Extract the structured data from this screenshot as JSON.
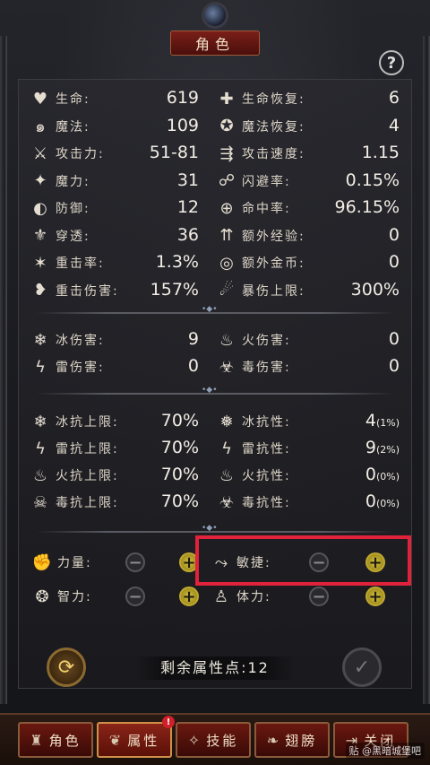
{
  "window": {
    "title": "角色"
  },
  "help": {
    "symbol": "?"
  },
  "stats_left": [
    {
      "icon": "heart-icon",
      "glyph": "♥",
      "label": "生命:",
      "value": "619"
    },
    {
      "icon": "swirl-icon",
      "glyph": "๑",
      "label": "魔法:",
      "value": "109"
    },
    {
      "icon": "sword-icon",
      "glyph": "⚔",
      "label": "攻击力:",
      "value": "51-81"
    },
    {
      "icon": "magic-icon",
      "glyph": "✦",
      "label": "魔力:",
      "value": "31"
    },
    {
      "icon": "shield-icon",
      "glyph": "◐",
      "label": "防御:",
      "value": "12"
    },
    {
      "icon": "fleur-icon",
      "glyph": "⚜",
      "label": "穿透:",
      "value": "36"
    },
    {
      "icon": "critical-icon",
      "glyph": "✶",
      "label": "重击率:",
      "value": "1.3%"
    },
    {
      "icon": "broken-heart-icon",
      "glyph": "❥",
      "label": "重击伤害:",
      "value": "157%"
    }
  ],
  "stats_right": [
    {
      "icon": "heart-plus-icon",
      "glyph": "✚",
      "label": "生命恢复:",
      "value": "6"
    },
    {
      "icon": "swirl-plus-icon",
      "glyph": "✪",
      "label": "魔法恢复:",
      "value": "4"
    },
    {
      "icon": "speed-icon",
      "glyph": "⇶",
      "label": "攻击速度:",
      "value": "1.15"
    },
    {
      "icon": "dodge-icon",
      "glyph": "☍",
      "label": "闪避率:",
      "value": "0.15%"
    },
    {
      "icon": "target-icon",
      "glyph": "⊕",
      "label": "命中率:",
      "value": "96.15%"
    },
    {
      "icon": "exp-up-icon",
      "glyph": "⇈",
      "label": "额外经验:",
      "value": "0"
    },
    {
      "icon": "coins-icon",
      "glyph": "◎",
      "label": "额外金币:",
      "value": "0"
    },
    {
      "icon": "crit-cap-icon",
      "glyph": "☄",
      "label": "暴伤上限:",
      "value": "300%"
    }
  ],
  "elem_damage": [
    {
      "icon": "ice-icon",
      "glyph": "❄",
      "label": "冰伤害:",
      "value": "9",
      "ricon": "fire-icon",
      "rglyph": "♨",
      "rlabel": "火伤害:",
      "rvalue": "0"
    },
    {
      "icon": "lightning-icon",
      "glyph": "ϟ",
      "label": "雷伤害:",
      "value": "0",
      "ricon": "poison-icon",
      "rglyph": "☣",
      "rlabel": "毒伤害:",
      "rvalue": "0"
    }
  ],
  "resists": [
    {
      "icon": "ice-cap-icon",
      "glyph": "❄",
      "label": "冰抗上限:",
      "value": "70%",
      "ricon": "ice-resist-icon",
      "rglyph": "❅",
      "rlabel": "冰抗性:",
      "rvalue": "4",
      "rpct": "(1%)"
    },
    {
      "icon": "lightning-cap-icon",
      "glyph": "ϟ",
      "label": "雷抗上限:",
      "value": "70%",
      "ricon": "lightning-resist-icon",
      "rglyph": "ϟ",
      "rlabel": "雷抗性:",
      "rvalue": "9",
      "rpct": "(2%)"
    },
    {
      "icon": "fire-cap-icon",
      "glyph": "♨",
      "label": "火抗上限:",
      "value": "70%",
      "ricon": "fire-resist-icon",
      "rglyph": "♨",
      "rlabel": "火抗性:",
      "rvalue": "0",
      "rpct": "(0%)"
    },
    {
      "icon": "poison-cap-icon",
      "glyph": "☠",
      "label": "毒抗上限:",
      "value": "70%",
      "ricon": "poison-resist-icon",
      "rglyph": "☣",
      "rlabel": "毒抗性:",
      "rvalue": "0",
      "rpct": "(0%)"
    }
  ],
  "attributes": {
    "strength": {
      "label": "力量:",
      "glyph": "✊"
    },
    "agility": {
      "label": "敏捷:",
      "glyph": "⤳"
    },
    "intellect": {
      "label": "智力:",
      "glyph": "❂"
    },
    "stamina": {
      "label": "体力:",
      "glyph": "♙"
    },
    "minus": "−",
    "plus": "+"
  },
  "remaining": {
    "text": "剩余属性点:12"
  },
  "buttons": {
    "refresh": "⟳",
    "confirm": "✓"
  },
  "tabs": [
    {
      "label": "角色",
      "glyph": "♜"
    },
    {
      "label": "属性",
      "glyph": "❦"
    },
    {
      "label": "技能",
      "glyph": "✧"
    },
    {
      "label": "翅膀",
      "glyph": "❧"
    },
    {
      "label": "关闭",
      "glyph": "⇥"
    }
  ],
  "tab_badge": "!",
  "watermark": "贴 @黑暗城堡吧",
  "colors": {
    "highlight": "#e0223a",
    "accent_gold": "#d8c040",
    "tab_red": "#6a1810"
  }
}
